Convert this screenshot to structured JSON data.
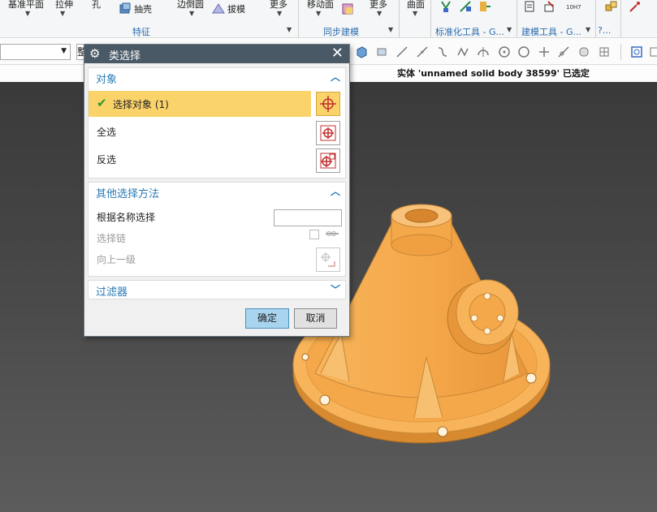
{
  "ribbon": {
    "labels": [
      "基准平面",
      "拉伸",
      "孔",
      "抽壳",
      "边倒圆",
      "拔模",
      "更多",
      "移动面",
      "更多",
      "曲面"
    ],
    "groups": [
      "特征",
      "同步建模",
      "标准化工具 - G...",
      "建模工具 - G...",
      "?..."
    ],
    "small_icon_text": "10H7"
  },
  "toolbar": {
    "combo_value": "",
    "combo2_value": "整"
  },
  "status": {
    "message": "实体 'unnamed solid body 38599' 已选定"
  },
  "dialog": {
    "title": "类选择",
    "close": "✕",
    "section_object": {
      "header": "对象",
      "select_objects": "选择对象 (1)",
      "select_all": "全选",
      "invert": "反选"
    },
    "section_other": {
      "header": "其他选择方法",
      "by_name": "根据名称选择",
      "by_name_value": "",
      "select_chain": "选择链",
      "up_one_level": "向上一级"
    },
    "section_filter": {
      "header": "过滤器"
    },
    "ok": "确定",
    "cancel": "取消"
  },
  "colors": {
    "part": "#f5a84a",
    "dialog_title": "#4a5966",
    "accent": "#2b7bb5",
    "selected_row": "#fbd36b"
  }
}
